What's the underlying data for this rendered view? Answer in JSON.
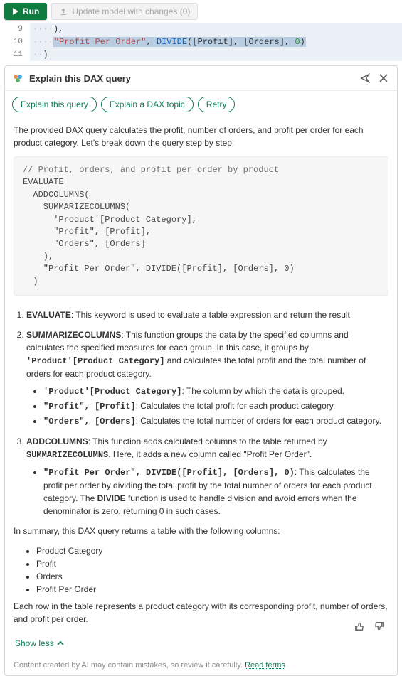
{
  "toolbar": {
    "run_label": "Run",
    "update_label": "Update model with changes (0)"
  },
  "editor": {
    "lines": [
      {
        "n": "9",
        "ws": "····",
        "rest_raw": "),",
        "sel": false
      },
      {
        "n": "10",
        "ws": "····",
        "rest_raw": "\"Profit·Per·Order\", DIVIDE([Profit], [Orders],·0)",
        "sel": true,
        "tokens": [
          {
            "t": "str",
            "v": "\"Profit"
          },
          {
            "t": "ws",
            "v": "·"
          },
          {
            "t": "str",
            "v": "Per"
          },
          {
            "t": "ws",
            "v": "·"
          },
          {
            "t": "str",
            "v": "Order\""
          },
          {
            "t": "punc",
            "v": ", "
          },
          {
            "t": "fn",
            "v": "DIVIDE"
          },
          {
            "t": "punc",
            "v": "([Profit], [Orders],"
          },
          {
            "t": "ws",
            "v": "·"
          },
          {
            "t": "num",
            "v": "0"
          },
          {
            "t": "punc",
            "v": ")"
          }
        ]
      },
      {
        "n": "11",
        "ws": "··",
        "rest_raw": ")",
        "sel": false
      }
    ]
  },
  "panel": {
    "title": "Explain this DAX query",
    "chips": [
      "Explain this query",
      "Explain a DAX topic",
      "Retry"
    ],
    "intro": "The provided DAX query calculates the profit, number of orders, and profit per order for each product category. Let's break down the query step by step:",
    "codeblock": "// Profit, orders, and profit per order by product\nEVALUATE\n  ADDCOLUMNS(\n    SUMMARIZECOLUMNS(\n      'Product'[Product Category],\n      \"Profit\", [Profit],\n      \"Orders\", [Orders]\n    ),\n    \"Profit Per Order\", DIVIDE([Profit], [Orders], 0)\n  )",
    "items": [
      {
        "kw": "EVALUATE",
        "text": ": This keyword is used to evaluate a table expression and return the result."
      },
      {
        "kw": "SUMMARIZECOLUMNS",
        "text_html": ": This function groups the data by the specified columns and calculates the specified measures for each group. In this case, it groups by <span class='mono'>'Product'[Product Category]</span> and calculates the total profit and the total number of orders for each product category.",
        "bullets": [
          "<span class='mono'>'Product'[Product Category]</span>: The column by which the data is grouped.",
          "<span class='mono'>\"Profit\", [Profit]</span>: Calculates the total profit for each product category.",
          "<span class='mono'>\"Orders\", [Orders]</span>: Calculates the total number of orders for each product category."
        ]
      },
      {
        "kw": "ADDCOLUMNS",
        "text_html": ": This function adds calculated columns to the table returned by <span class='mono'>SUMMARIZECOLUMNS</span>. Here, it adds a new column called \"Profit Per Order\".",
        "bullets": [
          "<span class='mono'>\"Profit Per Order\", DIVIDE([Profit], [Orders], 0)</span>: This calculates the profit per order by dividing the total profit by the total number of orders for each product category. The <strong>DIVIDE</strong> function is used to handle division and avoid errors when the denominator is zero, returning 0 in such cases."
        ]
      }
    ],
    "summary_lead": "In summary, this DAX query returns a table with the following columns:",
    "summary_cols": [
      "Product Category",
      "Profit",
      "Orders",
      "Profit Per Order"
    ],
    "summary_tail": "Each row in the table represents a product category with its corresponding profit, number of orders, and profit per order.",
    "showless": "Show less",
    "disclaimer_text": "Content created by AI may contain mistakes, so review it carefully. ",
    "disclaimer_link": "Read terms"
  }
}
